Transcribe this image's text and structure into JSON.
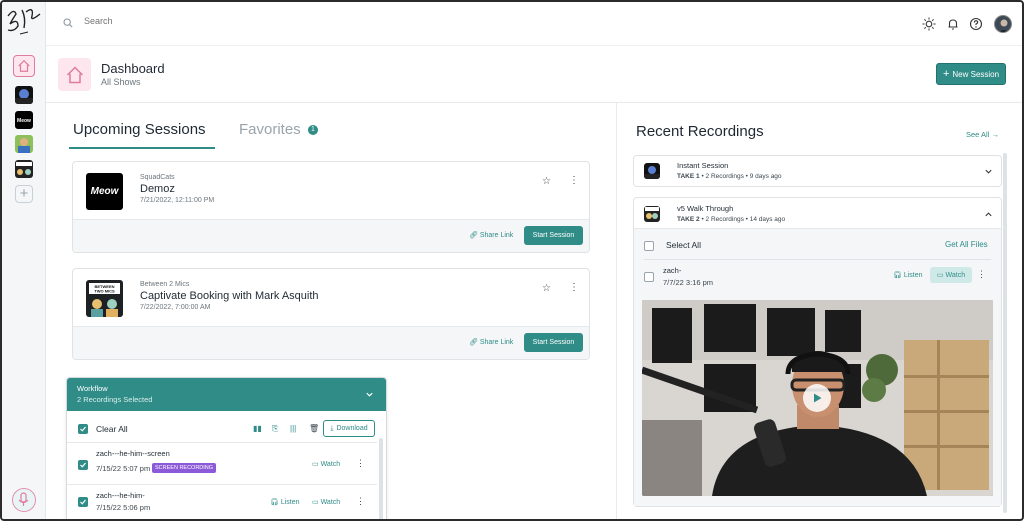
{
  "search": {
    "placeholder": "Search"
  },
  "header": {
    "title": "Dashboard",
    "subtitle": "All Shows",
    "new_session_label": "New Session"
  },
  "tabs": {
    "upcoming": "Upcoming Sessions",
    "favorites": "Favorites",
    "favorites_count": "1"
  },
  "sessions": [
    {
      "show": "SquadCats",
      "title": "Demoz",
      "date": "7/21/2022, 12:11:00 PM",
      "thumb_text": "Meow",
      "share_label": "Share Link",
      "start_label": "Start Session"
    },
    {
      "show": "Between 2 Mics",
      "title": "Captivate Booking with Mark Asquith",
      "date": "7/22/2022, 7:00:00 AM",
      "thumb_text": "BETWEEN TWO MICS",
      "share_label": "Share Link",
      "start_label": "Start Session"
    }
  ],
  "workflow": {
    "title": "Workflow",
    "subtitle": "2 Recordings Selected",
    "clear_all": "Clear All",
    "download_label": "Download",
    "rows": [
      {
        "title": "zach---he-him--screen",
        "date": "7/15/22 5:07 pm",
        "badge": "SCREEN RECORDING",
        "watch": "Watch"
      },
      {
        "title": "zach---he-him-",
        "date": "7/15/22 5:06 pm",
        "listen": "Listen",
        "watch": "Watch"
      }
    ]
  },
  "recent": {
    "title": "Recent Recordings",
    "see_all": "See All",
    "items": [
      {
        "name": "Instant Session",
        "take": "TAKE 1",
        "recordings": "2 Recordings",
        "ago": "9 days ago"
      },
      {
        "name": "v5 Walk Through",
        "take": "TAKE 2",
        "recordings": "2 Recordings",
        "ago": "14 days ago"
      }
    ],
    "select_all": "Select All",
    "get_all_files": "Get All Files",
    "recording": {
      "name": "zach-",
      "date": "7/7/22 3:16 pm",
      "listen": "Listen",
      "watch": "Watch"
    }
  },
  "colors": {
    "accent": "#2f8c87",
    "pink": "#e07b9c",
    "badge_purple": "#8c5ad8"
  }
}
